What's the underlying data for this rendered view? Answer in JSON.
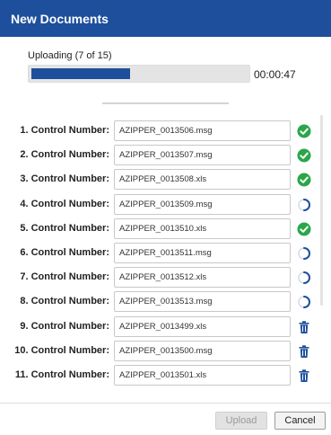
{
  "dialog": {
    "title": "New Documents"
  },
  "upload": {
    "status_text": "Uploading (7 of 15)",
    "progress_fraction": 0.46,
    "elapsed": "00:00:47",
    "accent_color": "#1d4f9c"
  },
  "rows": [
    {
      "label": "1. Control Number:",
      "value": "AZIPPER_0013506.msg",
      "status": "check-circle-icon"
    },
    {
      "label": "2. Control Number:",
      "value": "AZIPPER_0013507.msg",
      "status": "check-circle-icon"
    },
    {
      "label": "3. Control Number:",
      "value": "AZIPPER_0013508.xls",
      "status": "check-circle-icon"
    },
    {
      "label": "4. Control Number:",
      "value": "AZIPPER_0013509.msg",
      "status": "spinner-icon"
    },
    {
      "label": "5. Control Number:",
      "value": "AZIPPER_0013510.xls",
      "status": "check-circle-icon"
    },
    {
      "label": "6. Control Number:",
      "value": "AZIPPER_0013511.msg",
      "status": "spinner-icon"
    },
    {
      "label": "7. Control Number:",
      "value": "AZIPPER_0013512.xls",
      "status": "spinner-icon"
    },
    {
      "label": "8. Control Number:",
      "value": "AZIPPER_0013513.msg",
      "status": "spinner-icon"
    },
    {
      "label": "9. Control Number:",
      "value": "AZIPPER_0013499.xls",
      "status": "trash-icon"
    },
    {
      "label": "10. Control Number:",
      "value": "AZIPPER_0013500.msg",
      "status": "trash-icon"
    },
    {
      "label": "11. Control Number:",
      "value": "AZIPPER_0013501.xls",
      "status": "trash-icon"
    }
  ],
  "colors": {
    "success": "#2aa64a",
    "trash": "#1d4f9c",
    "spinner": "#1d4f9c"
  },
  "footer": {
    "upload_label": "Upload",
    "cancel_label": "Cancel"
  }
}
